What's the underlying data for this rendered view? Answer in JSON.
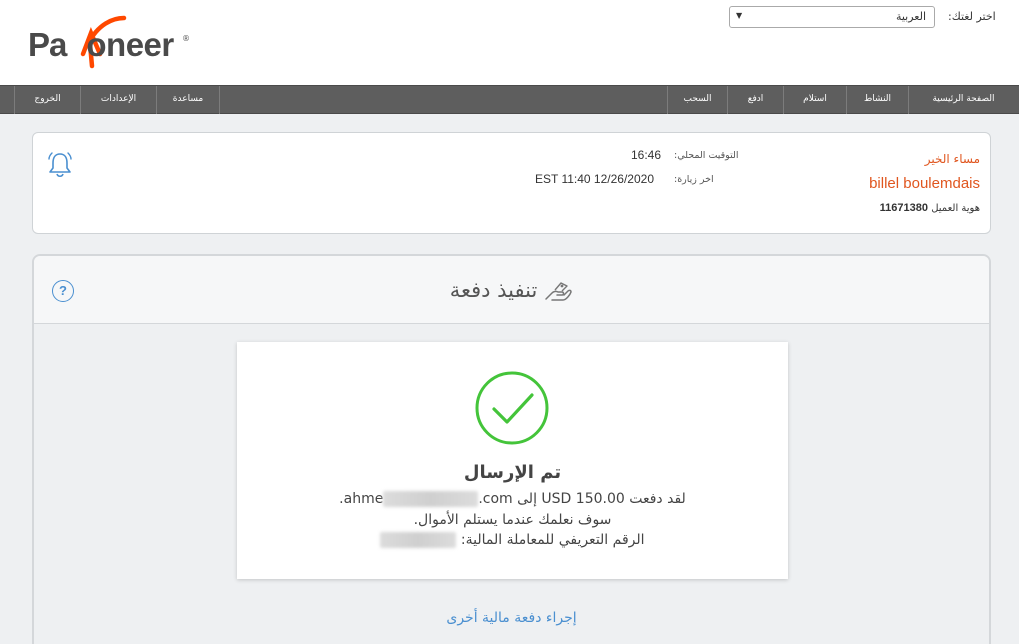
{
  "brand": {
    "name": "Payoneer",
    "reg": "®"
  },
  "language": {
    "label": "اختر لغتك:",
    "selected": "العربية"
  },
  "nav": {
    "right": [
      "الصفحة الرئيسية",
      "النشاط",
      "استلام",
      "ادفع",
      "السحب"
    ],
    "left": [
      "مساعدة",
      "الإعدادات",
      "الخروج"
    ]
  },
  "info": {
    "greeting": "مساء الخير",
    "username": "billel boulemdais",
    "customer_id_label": "هوية العميل",
    "customer_id": "11671380",
    "local_time_label": "التوقيت المحلي:",
    "local_time": "16:46",
    "last_visit_label": "اخر زيارة:",
    "last_visit": "EST 11:40 12/26/2020"
  },
  "panel": {
    "title": "تنفيذ دفعة",
    "help": "?",
    "success": {
      "title": "تم الإرسال",
      "line1_prefix": "لقد دفعت",
      "amount": "USD 150.00",
      "line1_to": "إلى",
      "email_start": "ahme",
      "email_end": ".com",
      "period": ".",
      "line2": "سوف نعلمك عندما يستلم الأموال.",
      "line3": "الرقم التعريفي للمعاملة المالية:"
    },
    "again_link": "إجراء دفعة مالية أخرى"
  },
  "colors": {
    "accent": "#e0561f",
    "link": "#4a8fd0",
    "success": "#44c43a",
    "nav": "#5e5e5e"
  }
}
